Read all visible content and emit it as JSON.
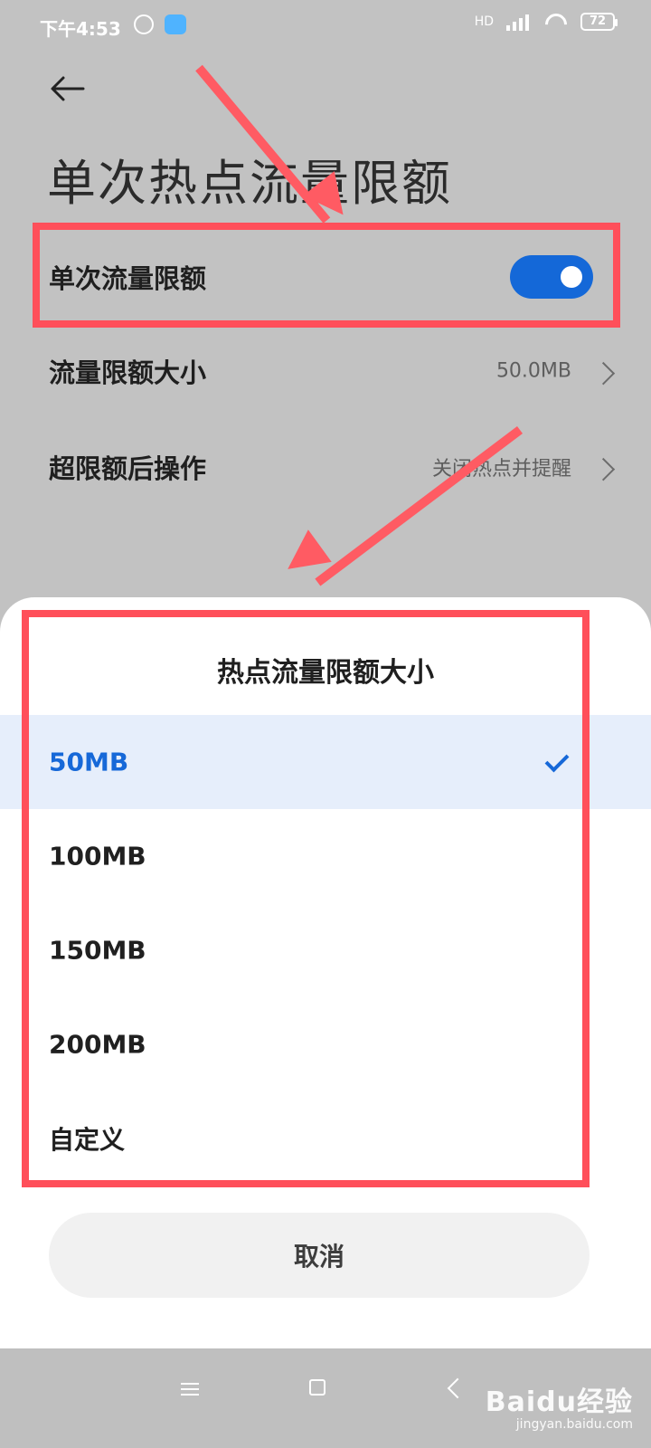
{
  "status_bar": {
    "time": "下午4:53",
    "network": "HD",
    "battery": "72"
  },
  "page": {
    "title": "单次热点流量限额"
  },
  "settings": {
    "single_limit": {
      "label": "单次流量限额",
      "enabled": true
    },
    "limit_size": {
      "label": "流量限额大小",
      "value": "50.0MB"
    },
    "after_limit_action": {
      "label": "超限额后操作",
      "value": "关闭热点并提醒"
    }
  },
  "dialog": {
    "title": "热点流量限额大小",
    "options": [
      {
        "label": "50MB",
        "selected": true
      },
      {
        "label": "100MB",
        "selected": false
      },
      {
        "label": "150MB",
        "selected": false
      },
      {
        "label": "200MB",
        "selected": false
      },
      {
        "label": "自定义",
        "selected": false
      }
    ],
    "cancel_label": "取消"
  },
  "watermark": {
    "brand": "Baidu经验",
    "url": "jingyan.baidu.com"
  },
  "colors": {
    "accent": "#1468d8",
    "highlight": "#ff4f5a",
    "selected_row": "#e6eefb"
  },
  "icons": {
    "back": "back-arrow-icon",
    "chevron": "chevron-right-icon",
    "check": "check-icon"
  }
}
